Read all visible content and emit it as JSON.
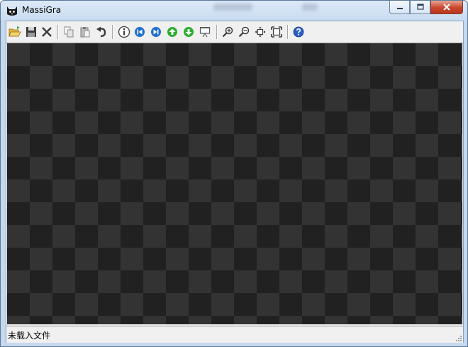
{
  "window": {
    "title": "MassiGra"
  },
  "toolbar": {
    "buttons": [
      {
        "name": "open-icon"
      },
      {
        "name": "save-icon"
      },
      {
        "name": "close-file-icon"
      },
      {
        "name": "copy-icon"
      },
      {
        "name": "paste-icon"
      },
      {
        "name": "undo-icon"
      },
      {
        "name": "info-icon"
      },
      {
        "name": "first-image-icon"
      },
      {
        "name": "last-image-icon"
      },
      {
        "name": "previous-image-icon"
      },
      {
        "name": "next-image-icon"
      },
      {
        "name": "slideshow-icon"
      },
      {
        "name": "zoom-in-icon"
      },
      {
        "name": "zoom-out-icon"
      },
      {
        "name": "fit-window-icon"
      },
      {
        "name": "actual-size-icon"
      },
      {
        "name": "help-icon"
      }
    ]
  },
  "status": {
    "text": "未载入文件"
  },
  "colors": {
    "checker_dark": "#212121",
    "checker_light": "#333333",
    "nav_blue": "#1f6fd0",
    "nav_green": "#2fae2f",
    "help_blue": "#2a5fc8"
  }
}
